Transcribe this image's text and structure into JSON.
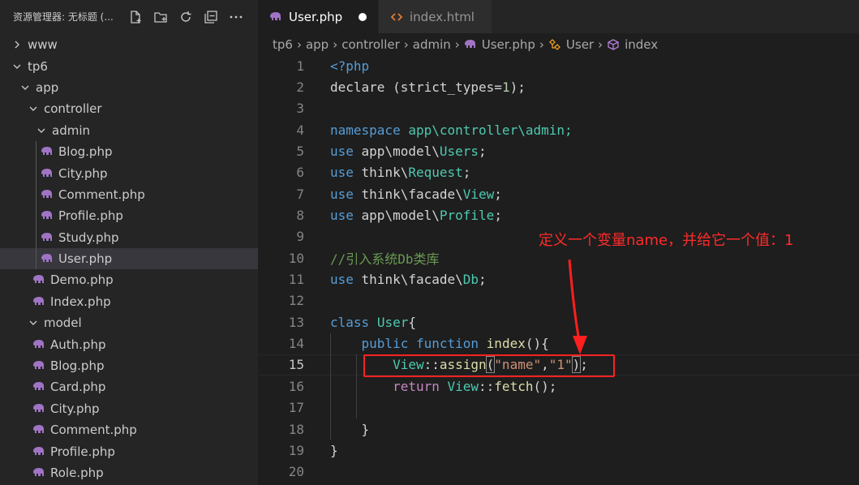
{
  "sidebar": {
    "title": "资源管理器: 无标题 (...",
    "actions": [
      {
        "name": "new-file-icon"
      },
      {
        "name": "new-folder-icon"
      },
      {
        "name": "refresh-icon"
      },
      {
        "name": "collapse-all-icon"
      },
      {
        "name": "more-icon"
      }
    ],
    "tree": [
      {
        "label": "www",
        "type": "folder",
        "open": false,
        "depth": 0
      },
      {
        "label": "tp6",
        "type": "folder",
        "open": true,
        "depth": 0
      },
      {
        "label": "app",
        "type": "folder",
        "open": true,
        "depth": 1
      },
      {
        "label": "controller",
        "type": "folder",
        "open": true,
        "depth": 2
      },
      {
        "label": "admin",
        "type": "folder",
        "open": true,
        "depth": 3
      },
      {
        "label": "Blog.php",
        "type": "php",
        "depth": 4
      },
      {
        "label": "City.php",
        "type": "php",
        "depth": 4
      },
      {
        "label": "Comment.php",
        "type": "php",
        "depth": 4
      },
      {
        "label": "Profile.php",
        "type": "php",
        "depth": 4
      },
      {
        "label": "Study.php",
        "type": "php",
        "depth": 4
      },
      {
        "label": "User.php",
        "type": "php",
        "depth": 4,
        "selected": true
      },
      {
        "label": "Demo.php",
        "type": "php",
        "depth": 3
      },
      {
        "label": "Index.php",
        "type": "php",
        "depth": 3
      },
      {
        "label": "model",
        "type": "folder",
        "open": true,
        "depth": 2
      },
      {
        "label": "Auth.php",
        "type": "php",
        "depth": 3
      },
      {
        "label": "Blog.php",
        "type": "php",
        "depth": 3
      },
      {
        "label": "Card.php",
        "type": "php",
        "depth": 3
      },
      {
        "label": "City.php",
        "type": "php",
        "depth": 3
      },
      {
        "label": "Comment.php",
        "type": "php",
        "depth": 3
      },
      {
        "label": "Profile.php",
        "type": "php",
        "depth": 3
      },
      {
        "label": "Role.php",
        "type": "php",
        "depth": 3
      }
    ]
  },
  "tabs": [
    {
      "label": "User.php",
      "active": true,
      "dirty": true,
      "icon": "php-elephant-icon"
    },
    {
      "label": "index.html",
      "active": false,
      "icon": "html-icon"
    }
  ],
  "breadcrumb": {
    "parts": [
      "tp6",
      "app",
      "controller",
      "admin",
      "User.php",
      "User",
      "index"
    ]
  },
  "code": {
    "current_line": 15,
    "lines": [
      [
        {
          "t": "<?php",
          "c": "kw"
        }
      ],
      [
        {
          "t": "declare",
          "c": "txt"
        },
        {
          "t": " (strict_types=",
          "c": "txt"
        },
        {
          "t": "1",
          "c": "num"
        },
        {
          "t": ");",
          "c": "txt"
        }
      ],
      [],
      [
        {
          "t": "namespace",
          "c": "kw"
        },
        {
          "t": " app\\controller\\admin;",
          "c": "cls"
        }
      ],
      [
        {
          "t": "use",
          "c": "kw"
        },
        {
          "t": " app\\model\\",
          "c": "txt"
        },
        {
          "t": "Users",
          "c": "cls"
        },
        {
          "t": ";",
          "c": "txt"
        }
      ],
      [
        {
          "t": "use",
          "c": "kw"
        },
        {
          "t": " think\\",
          "c": "txt"
        },
        {
          "t": "Request",
          "c": "cls"
        },
        {
          "t": ";",
          "c": "txt"
        }
      ],
      [
        {
          "t": "use",
          "c": "kw"
        },
        {
          "t": " think\\facade\\",
          "c": "txt"
        },
        {
          "t": "View",
          "c": "cls"
        },
        {
          "t": ";",
          "c": "txt"
        }
      ],
      [
        {
          "t": "use",
          "c": "kw"
        },
        {
          "t": " app\\model\\",
          "c": "txt"
        },
        {
          "t": "Profile",
          "c": "cls"
        },
        {
          "t": ";",
          "c": "txt"
        }
      ],
      [],
      [
        {
          "t": "//引入系统Db类库",
          "c": "cmt"
        }
      ],
      [
        {
          "t": "use",
          "c": "kw"
        },
        {
          "t": " think\\facade\\",
          "c": "txt"
        },
        {
          "t": "Db",
          "c": "cls"
        },
        {
          "t": ";",
          "c": "txt"
        }
      ],
      [],
      [
        {
          "t": "class",
          "c": "kw"
        },
        {
          "t": " ",
          "c": "txt"
        },
        {
          "t": "User",
          "c": "cls"
        },
        {
          "t": "{",
          "c": "txt"
        }
      ],
      [
        {
          "t": "    ",
          "c": "txt"
        },
        {
          "t": "public",
          "c": "kw"
        },
        {
          "t": " ",
          "c": "txt"
        },
        {
          "t": "function",
          "c": "kw"
        },
        {
          "t": " ",
          "c": "txt"
        },
        {
          "t": "index",
          "c": "fn"
        },
        {
          "t": "(){",
          "c": "txt"
        }
      ],
      [
        {
          "t": "        ",
          "c": "txt"
        },
        {
          "t": "View",
          "c": "cls"
        },
        {
          "t": "::",
          "c": "txt"
        },
        {
          "t": "assign",
          "c": "fn"
        },
        {
          "t": "(",
          "c": "brk"
        },
        {
          "t": "\"name\"",
          "c": "str"
        },
        {
          "t": ",",
          "c": "txt"
        },
        {
          "t": "\"1\"",
          "c": "str"
        },
        {
          "t": ")",
          "c": "brk"
        },
        {
          "t": ";",
          "c": "txt"
        }
      ],
      [
        {
          "t": "        ",
          "c": "txt"
        },
        {
          "t": "return",
          "c": "ctl"
        },
        {
          "t": " ",
          "c": "txt"
        },
        {
          "t": "View",
          "c": "cls"
        },
        {
          "t": "::",
          "c": "txt"
        },
        {
          "t": "fetch",
          "c": "fn"
        },
        {
          "t": "();",
          "c": "txt"
        }
      ],
      [],
      [
        {
          "t": "    }",
          "c": "txt"
        }
      ],
      [
        {
          "t": "}",
          "c": "txt"
        }
      ],
      []
    ]
  },
  "annotation": {
    "text": "定义一个变量name，并给它一个值：1",
    "color": "#ff2a2a"
  }
}
